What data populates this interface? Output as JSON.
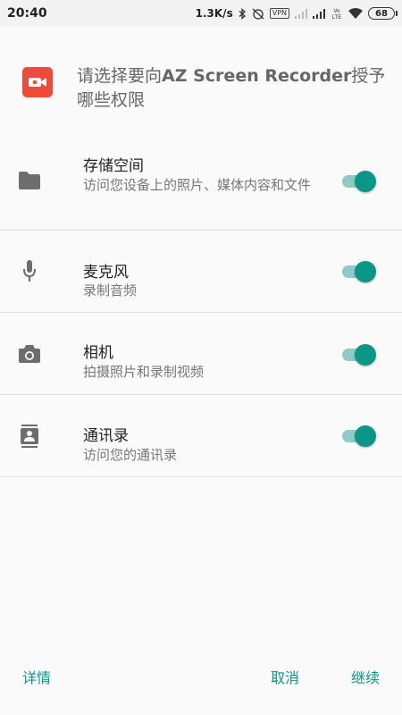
{
  "status_bar": {
    "time": "20:40",
    "net_speed": "1.3K/s",
    "vpn_label": "VPN",
    "volte_label": "VoLTE",
    "battery_level": "68",
    "icons": [
      "bluetooth-icon",
      "alarm-off-icon",
      "vpn-icon",
      "signal-weak-icon",
      "signal-icon",
      "volte-icon",
      "wifi-icon",
      "battery-icon"
    ]
  },
  "dialog": {
    "prompt_prefix": "请选择要向",
    "app_name": "AZ Screen Recorder",
    "prompt_suffix": "授予哪些权限",
    "app_icon": "screen-recorder-icon",
    "accent_color": "#0b9688",
    "app_icon_color": "#ef4b3c"
  },
  "permissions": [
    {
      "icon": "folder-icon",
      "title": "存储空间",
      "desc": "访问您设备上的照片、媒体内容和文件",
      "enabled": true
    },
    {
      "icon": "microphone-icon",
      "title": "麦克风",
      "desc": "录制音频",
      "enabled": true
    },
    {
      "icon": "camera-icon",
      "title": "相机",
      "desc": "拍摄照片和录制视频",
      "enabled": true
    },
    {
      "icon": "contacts-icon",
      "title": "通讯录",
      "desc": "访问您的通讯录",
      "enabled": true
    }
  ],
  "footer": {
    "details_label": "详情",
    "cancel_label": "取消",
    "continue_label": "继续"
  }
}
